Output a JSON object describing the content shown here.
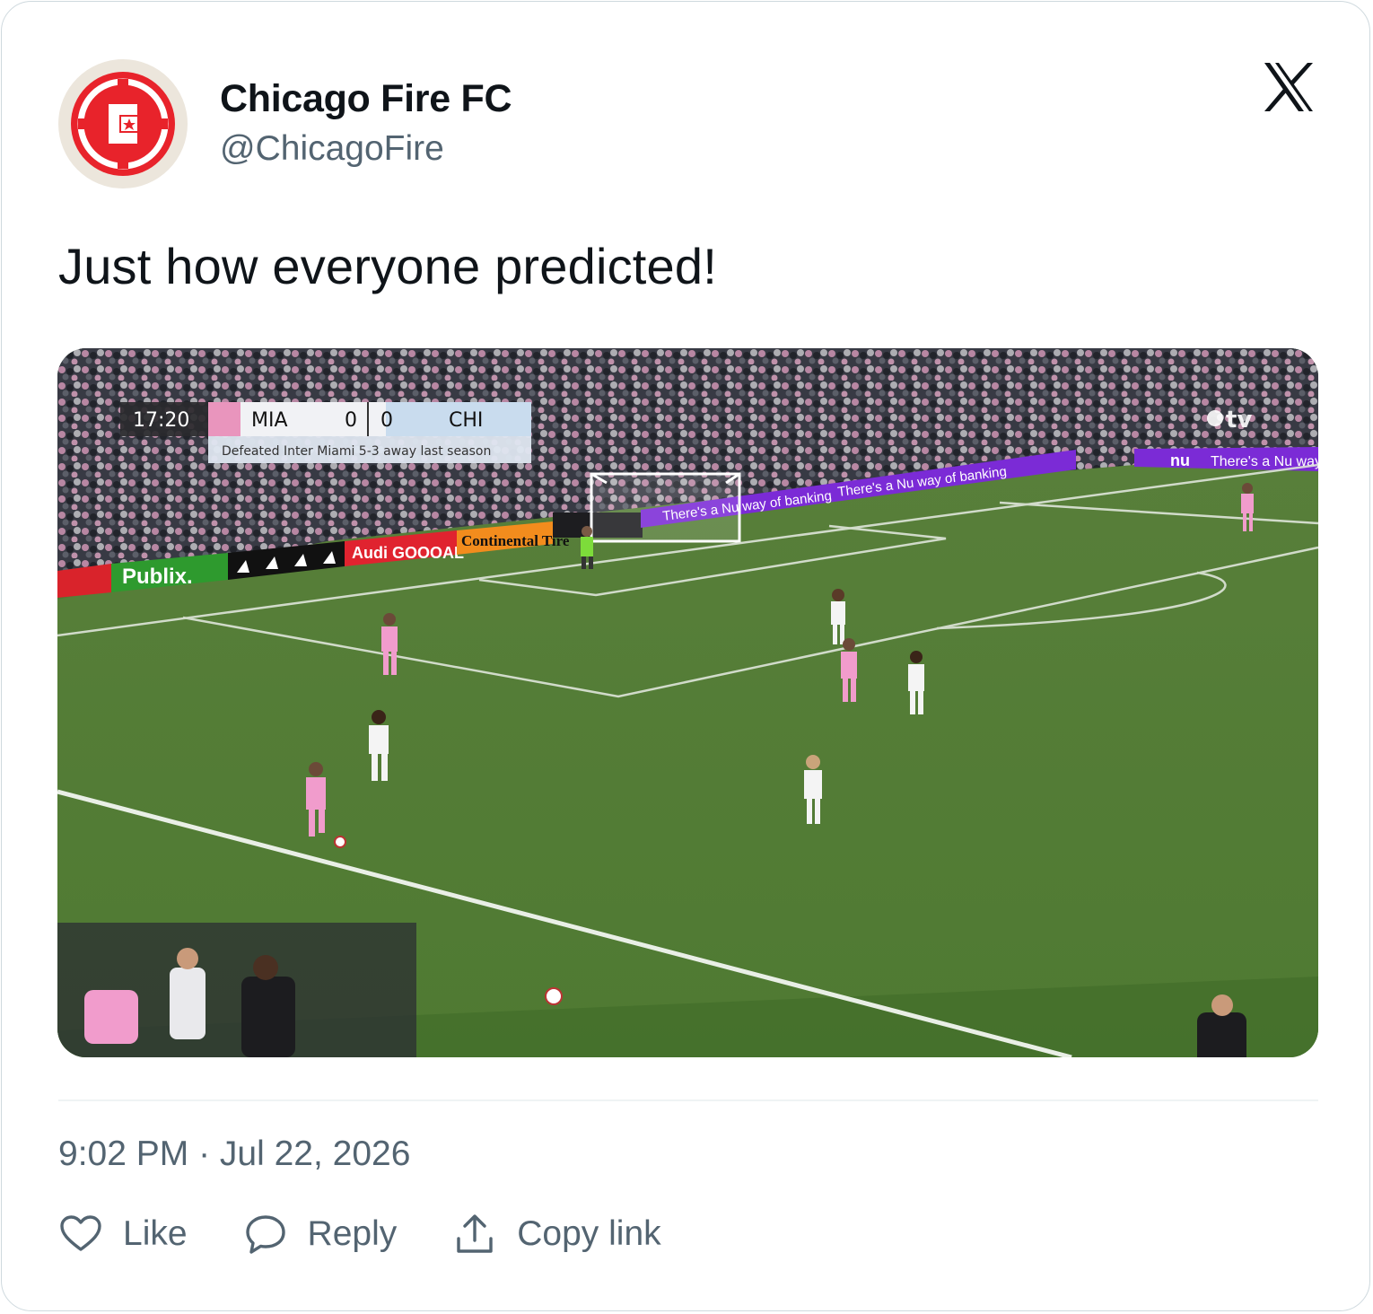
{
  "account": {
    "name": "Chicago Fire FC",
    "handle": "@ChicagoFire"
  },
  "post": {
    "text": "Just how everyone predicted!",
    "timestamp": "9:02 PM · Jul 22, 2026"
  },
  "scoreboard": {
    "clock": "17:20",
    "home": "MIA",
    "home_score": "0",
    "away_score": "0",
    "away": "CHI",
    "caption": "Defeated Inter Miami 5-3 away last season"
  },
  "broadcast": {
    "network": "tv"
  },
  "ads": {
    "publix": "Publix.",
    "audi": "Audi GOOOAL",
    "continental": "Continental Tire",
    "nu": "There's a Nu way of banking",
    "nu_logo": "nu"
  },
  "actions": {
    "like": "Like",
    "reply": "Reply",
    "copy": "Copy link"
  },
  "icons": {
    "platform": "x-logo-icon",
    "like": "heart-icon",
    "reply": "speech-bubble-icon",
    "copy": "share-upload-icon"
  },
  "colors": {
    "brand_red": "#e8232b",
    "text_primary": "#0f1419",
    "text_secondary": "#536471",
    "border": "#cfd9de",
    "pitch": "#5a8a3c"
  }
}
